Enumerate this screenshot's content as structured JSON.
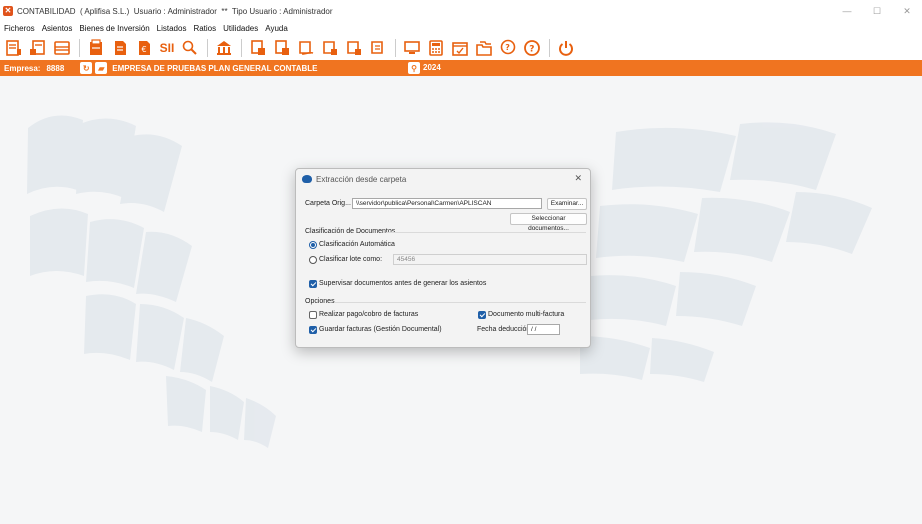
{
  "window": {
    "title": "CONTABILIDAD  ( Aplifisa S.L.)  Usuario : Administrador  **  Tipo Usuario : Administrador",
    "controls": {
      "minimize": "—",
      "maximize": "☐",
      "close": "✕"
    }
  },
  "menu": [
    "Ficheros",
    "Asientos",
    "Bienes de Inversión",
    "Listados",
    "Ratios",
    "Utilidades",
    "Ayuda"
  ],
  "toolbar": {
    "accent": "#f07420",
    "sii_label": "SII",
    "icons": [
      "ledger-icon",
      "journal-icon",
      "register-icon",
      "document-icon",
      "bill-icon",
      "euro-doc-icon",
      "sii-icon",
      "search-doc-icon",
      "bank-icon",
      "list-icon-1",
      "list-icon-2",
      "list-icon-3",
      "list-icon-4",
      "list-icon-5",
      "list-icon-6",
      "monitor-icon",
      "calculator-icon",
      "calendar-icon",
      "folders-icon",
      "help-chat-icon",
      "help-icon",
      "power-icon"
    ]
  },
  "company": {
    "label": "Empresa:",
    "code": "8888",
    "name": "EMPRESA DE PRUEBAS PLAN GENERAL CONTABLE",
    "year": "2024",
    "color": "#f07420"
  },
  "dialog": {
    "title": "Extracción desde carpeta",
    "close": "✕",
    "carpeta_label": "Carpeta Orig...",
    "carpeta_value": "\\\\servidor\\publica\\Personal\\Carmen\\APLISCAN",
    "examinar_button": "Examinar...",
    "seleccionar_button": "Seleccionar documentos...",
    "clasificacion_heading": "Clasificación de Documentos",
    "radio_auto": "Clasificación Automática",
    "radio_lote": "Clasificar lote como:",
    "lote_value": "45456",
    "supervisar_label": "Supervisar documentos antes de generar los asientos",
    "opciones_heading": "Opciones",
    "realizar_label": "Realizar pago/cobro de facturas",
    "guardar_label": "Guardar facturas (Gestión Documental)",
    "multifactura_label": "Documento multi-factura",
    "fecha_label": "Fecha deducción",
    "fecha_value": " /  /",
    "state": {
      "auto_selected": true,
      "supervisar": true,
      "realizar": false,
      "guardar": true,
      "multifactura": true
    }
  }
}
